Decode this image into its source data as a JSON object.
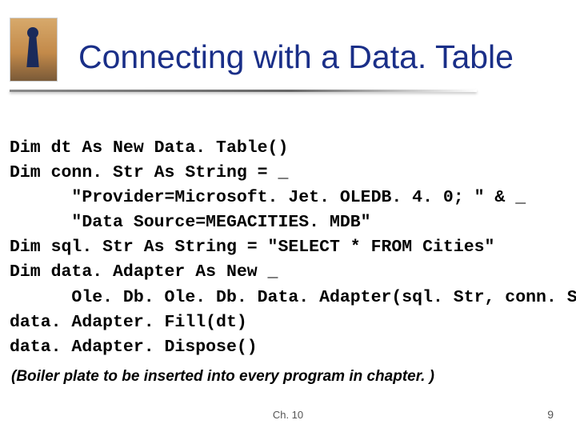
{
  "title": "Connecting with a Data. Table",
  "code_lines": [
    "Dim dt As New Data. Table()",
    "Dim conn. Str As String = _",
    "      \"Provider=Microsoft. Jet. OLEDB. 4. 0; \" & _",
    "      \"Data Source=MEGACITIES. MDB\"",
    "Dim sql. Str As String = \"SELECT * FROM Cities\"",
    "Dim data. Adapter As New _",
    "      Ole. Db. Ole. Db. Data. Adapter(sql. Str, conn. Str)",
    "data. Adapter. Fill(dt)",
    "data. Adapter. Dispose()"
  ],
  "note": "(Boiler plate to be inserted into every program in chapter. )",
  "chapter": "Ch. 10",
  "page": "9"
}
